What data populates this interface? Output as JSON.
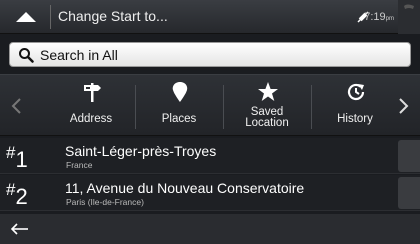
{
  "header": {
    "title": "Change Start to...",
    "time": "7:19",
    "ampm": "pm"
  },
  "search": {
    "placeholder": "Search in All"
  },
  "categories": [
    {
      "label_line1": "Address",
      "label_line2": "",
      "icon": "signpost-icon"
    },
    {
      "label_line1": "Places",
      "label_line2": "",
      "icon": "map-pin-icon"
    },
    {
      "label_line1": "Saved",
      "label_line2": "Location",
      "icon": "star-icon"
    },
    {
      "label_line1": "History",
      "label_line2": "",
      "icon": "history-icon"
    }
  ],
  "results": [
    {
      "rank_hash": "#",
      "rank_num": "1",
      "name": "Saint-Léger-près-Troyes",
      "sub": "France"
    },
    {
      "rank_hash": "#",
      "rank_num": "2",
      "name": "11, Avenue du Nouveau Conservatoire",
      "sub": "Paris (Ile-de-France)"
    }
  ],
  "colors": {
    "background": "#1a1c20",
    "search_bg": "#ffffff",
    "text": "#ffffff"
  }
}
